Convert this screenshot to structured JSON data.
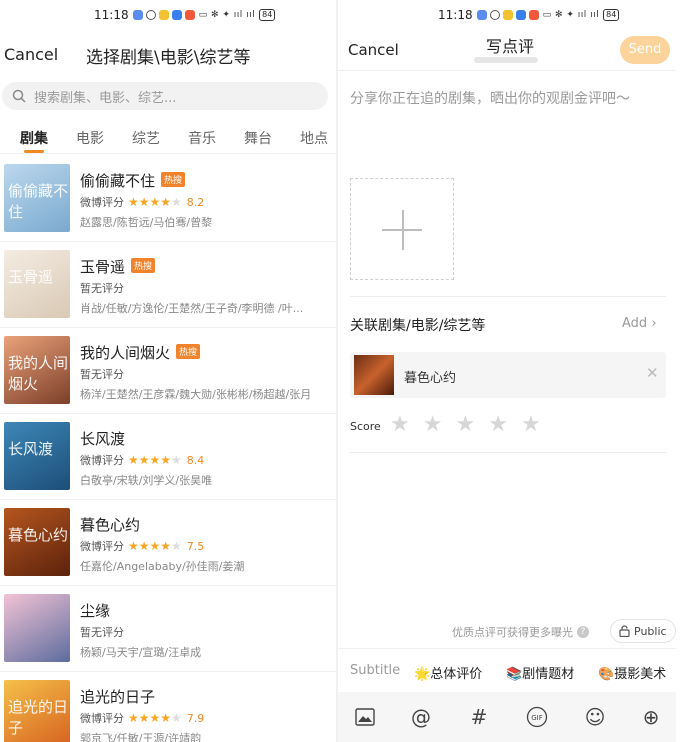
{
  "status_bar": {
    "left_time": "11:18",
    "right_time": "11:18",
    "battery": "84"
  },
  "left": {
    "cancel": "Cancel",
    "title": "选择剧集\\电影\\综艺等",
    "search_placeholder": "搜索剧集、电影、综艺...",
    "tabs": [
      "剧集",
      "电影",
      "综艺",
      "音乐",
      "舞台",
      "地点"
    ],
    "active_tab": "剧集",
    "hot_badge": "热搜",
    "rating_label": "微博评分",
    "no_rating": "暂无评分",
    "items": [
      {
        "title": "偷偷藏不住",
        "hot": true,
        "rated": true,
        "stars": 4,
        "score": "8.2",
        "cast": "赵露思/陈哲远/马伯骞/曾黎",
        "poster_colors": [
          "#bcd8ee",
          "#7aa9cf"
        ],
        "poster_text": "偷偷藏不住"
      },
      {
        "title": "玉骨遥",
        "hot": true,
        "rated": false,
        "cast": "肖战/任敏/方逸伦/王楚然/王子奇/李明德 /叶...",
        "poster_colors": [
          "#f4ece2",
          "#d9c9b4"
        ],
        "poster_text": "玉骨遥"
      },
      {
        "title": "我的人间烟火",
        "hot": true,
        "rated": false,
        "cast": "杨洋/王楚然/王彦霖/魏大勋/张彬彬/杨超越/张月",
        "poster_colors": [
          "#e9a27a",
          "#7d3f2a"
        ],
        "poster_text": "我的人间烟火"
      },
      {
        "title": "长风渡",
        "hot": false,
        "rated": true,
        "stars": 4,
        "score": "8.4",
        "cast": "白敬亭/宋轶/刘学义/张昊唯",
        "poster_colors": [
          "#3d87b8",
          "#1d4e78"
        ],
        "poster_text": "长风渡"
      },
      {
        "title": "暮色心约",
        "hot": false,
        "rated": true,
        "stars": 4,
        "score": "7.5",
        "cast": "任嘉伦/Angelababy/孙佳雨/姜潮",
        "poster_colors": [
          "#b5561f",
          "#5c220c"
        ],
        "poster_text": "暮色心约"
      },
      {
        "title": "尘缘",
        "hot": false,
        "rated": false,
        "cast": "杨颖/马天宇/宣璐/汪卓成",
        "poster_colors": [
          "#f3c3d5",
          "#5c6c9e"
        ],
        "poster_text": ""
      },
      {
        "title": "追光的日子",
        "hot": false,
        "rated": true,
        "stars": 4,
        "score": "7.9",
        "cast": "郭京飞/任敏/王源/许靖韵",
        "poster_colors": [
          "#f5c04a",
          "#d6601f"
        ],
        "poster_text": "追光的日子"
      }
    ]
  },
  "right": {
    "cancel": "Cancel",
    "title": "写点评",
    "send": "Send",
    "placeholder": "分享你正在追的剧集，晒出你的观剧金评吧～",
    "related_label": "关联剧集/电影/综艺等",
    "add_label": "Add",
    "linked_title": "暮色心约",
    "score_label": "Score",
    "tip": "优质点评可获得更多曝光",
    "public_label": "Public",
    "chips": [
      {
        "label": "Subtitle",
        "emoji": ""
      },
      {
        "label": "总体评价",
        "emoji": "🌟"
      },
      {
        "label": "剧情题材",
        "emoji": "📚"
      },
      {
        "label": "摄影美术",
        "emoji": "🎨"
      }
    ],
    "toolbar_icons": [
      "image-icon",
      "mention-icon",
      "hashtag-icon",
      "gif-icon",
      "emoji-icon",
      "plus-circle-icon"
    ],
    "gif_label": "GIF"
  },
  "colors": {
    "accent": "#f08a24",
    "star": "#f6a623",
    "send_disabled": "#fcd39a",
    "hot_badge": "#f0832c"
  }
}
